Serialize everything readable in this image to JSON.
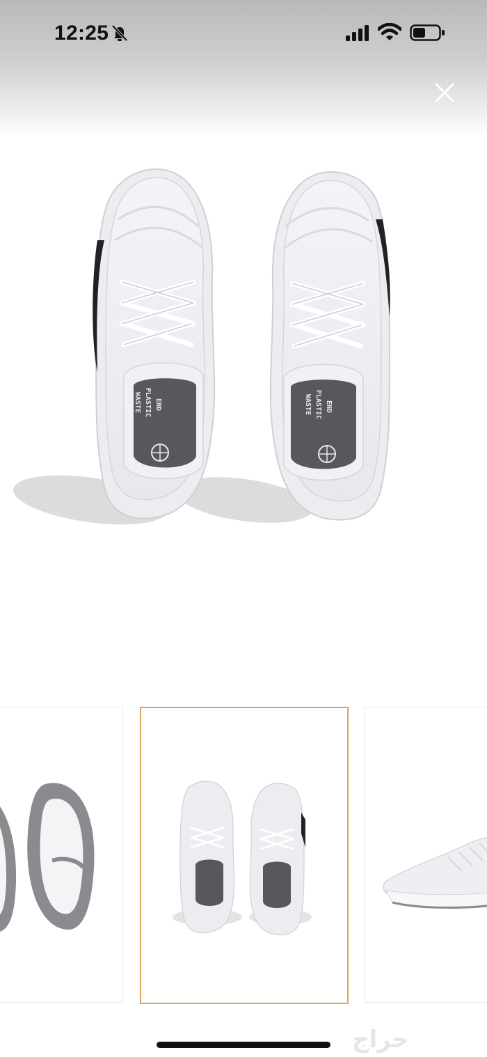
{
  "status_bar": {
    "time": "12:25",
    "icons": [
      "bell-muted-icon",
      "cellular-signal-icon",
      "wifi-icon",
      "battery-icon"
    ]
  },
  "viewer": {
    "close_icon": "close-icon",
    "selected_index": 1,
    "thumbnails": [
      "shoe-soles-view",
      "shoe-top-view",
      "shoe-side-view"
    ]
  },
  "insole_text": [
    "END",
    "PLASTIC",
    "WASTE"
  ],
  "watermark": "حراج",
  "colors": {
    "selection_border": "#e0a35a",
    "status_gradient_top": "#b9b9b9"
  }
}
